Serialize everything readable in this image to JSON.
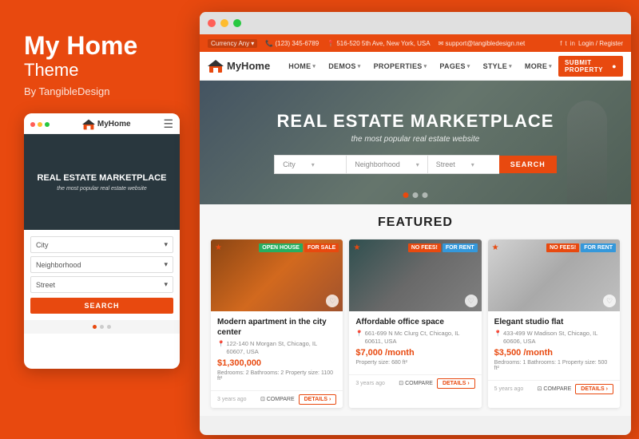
{
  "left": {
    "title": "My Home",
    "subtitle": "Theme",
    "by": "By TangibleDesign"
  },
  "mobile": {
    "logo": "MyHome",
    "hero_title": "REAL ESTATE MARKETPLACE",
    "hero_sub": "the most popular real estate website",
    "city_label": "City",
    "neighborhood_label": "Neighborhood",
    "street_label": "Street",
    "search_label": "SEARCH"
  },
  "browser": {
    "topbar": {
      "currency_label": "Currency",
      "currency_value": "Any",
      "phone": "📞 (123) 345-6789",
      "address": "📍 516-520 5th Ave, New York, USA",
      "email": "✉ support@tangibledesign.net",
      "login": "Login / Register"
    },
    "navbar": {
      "logo": "MyHome",
      "home": "HOME",
      "demos": "DEMOS",
      "properties": "PROPERTIES",
      "pages": "PAGES",
      "style": "STYLE",
      "more": "MORE",
      "submit": "SUBMIT PROPERTY"
    },
    "hero": {
      "title": "REAL ESTATE MARKETPLACE",
      "subtitle": "the most popular real estate website",
      "city_placeholder": "City",
      "neighborhood_placeholder": "Neighborhood",
      "street_placeholder": "Street",
      "search_btn": "SEARCH"
    },
    "featured": {
      "title": "FEATURED",
      "properties": [
        {
          "name": "Modern apartment in the city center",
          "address": "122-140 N Morgan St, Chicago, IL 60607, USA",
          "price": "$1,300,000",
          "details": "Bedrooms: 2  Bathrooms: 2  Property size: 1100 ft²",
          "time": "3 years ago",
          "badges": [
            "OPEN HOUSE",
            "FOR SALE"
          ],
          "img_class": "prop-img-1"
        },
        {
          "name": "Affordable office space",
          "address": "661-699 N Mc Clurg Ct, Chicago, IL 60611, USA",
          "price": "$7,000 /month",
          "details": "Property size: 680 ft²",
          "time": "3 years ago",
          "badges": [
            "NO FEES!",
            "FOR RENT"
          ],
          "img_class": "prop-img-2"
        },
        {
          "name": "Elegant studio flat",
          "address": "433-499 W Madison St, Chicago, IL 60606, USA",
          "price": "$3,500 /month",
          "details": "Bedrooms: 1  Bathrooms: 1  Property size: 500 ft²",
          "time": "5 years ago",
          "badges": [
            "NO FEES!",
            "FOR RENT"
          ],
          "img_class": "prop-img-3"
        }
      ]
    }
  },
  "icons": {
    "home_icon": "⌂",
    "phone_icon": "📞",
    "pin_icon": "📍",
    "mail_icon": "✉",
    "chevron": "▾",
    "hamburger": "☰",
    "heart": "♡",
    "compare": "⊡",
    "star": "★",
    "arrow_right": "›",
    "map_pin": "📍"
  }
}
